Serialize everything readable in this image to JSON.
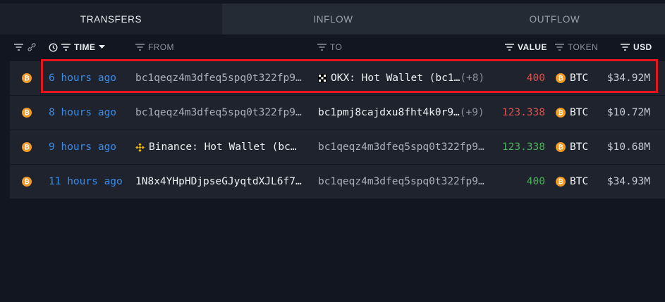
{
  "tabs": [
    {
      "label": "TRANSFERS"
    },
    {
      "label": "INFLOW"
    },
    {
      "label": "OUTFLOW"
    }
  ],
  "columns": {
    "time": "TIME",
    "from": "FROM",
    "to": "TO",
    "value": "VALUE",
    "token": "TOKEN",
    "usd": "USD"
  },
  "rows": [
    {
      "time": "6 hours ago",
      "from": "bc1qeqz4m3dfeq5spq0t322fp9…",
      "to": "OKX: Hot Wallet (bc1…",
      "to_extra": "(+8)",
      "value": "400",
      "value_color": "#d9534f",
      "token": "BTC",
      "usd": "$34.92M"
    },
    {
      "time": "8 hours ago",
      "from": "bc1qeqz4m3dfeq5spq0t322fp9…",
      "to": "bc1pmj8cajdxu8fht4k0r9…",
      "to_extra": "(+9)",
      "value": "123.338",
      "value_color": "#d9534f",
      "token": "BTC",
      "usd": "$10.72M"
    },
    {
      "time": "9 hours ago",
      "from": "Binance: Hot Wallet (bc…",
      "to": "bc1qeqz4m3dfeq5spq0t322fp9…",
      "value": "123.338",
      "value_color": "#4dae5b",
      "token": "BTC",
      "usd": "$10.68M"
    },
    {
      "time": "11 hours ago",
      "from": "1N8x4YHpHDjpseGJyqtdXJL6f7…",
      "to": "bc1qeqz4m3dfeq5spq0t322fp9…",
      "value": "400",
      "value_color": "#4dae5b",
      "token": "BTC",
      "usd": "$34.93M"
    }
  ],
  "colors": {
    "background": "#121620",
    "row_background": "#1e232d",
    "link_blue": "#3c8be6",
    "outflow_red": "#d9534f",
    "inflow_green": "#4dae5b",
    "btc_orange": "#f29a26",
    "highlight_red": "#e8141d"
  },
  "icons": {
    "filter": "filter-lines-icon",
    "link": "chain-link-icon",
    "clock": "clock-icon",
    "sort": "caret-down-icon",
    "token": "bitcoin-icon",
    "okx": "okx-logo-icon",
    "binance": "binance-logo-icon"
  }
}
